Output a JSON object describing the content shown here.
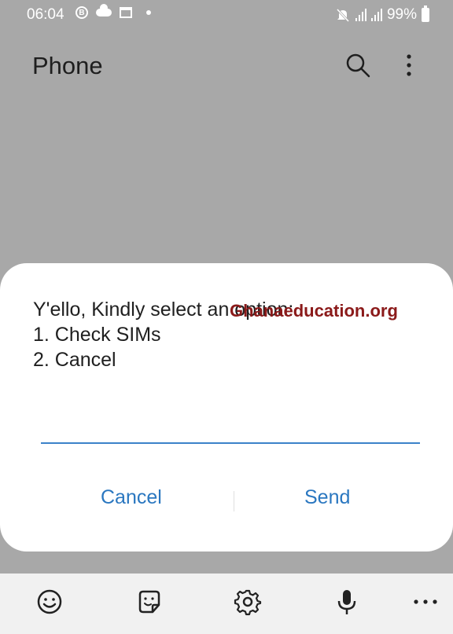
{
  "status_bar": {
    "time": "06:04",
    "badge_letter": "B",
    "battery": "99%"
  },
  "app_bar": {
    "title": "Phone",
    "icons": [
      "search-icon",
      "more-vert-icon"
    ]
  },
  "dialog": {
    "message_lines": [
      "Y'ello, Kindly select an option:",
      "1. Check SIMs",
      "2. Cancel"
    ],
    "watermark": "Ghanaeducation.org",
    "input_value": "",
    "cancel_label": "Cancel",
    "send_label": "Send"
  },
  "toolbar": {
    "icons": [
      "emoji-icon",
      "sticker-icon",
      "settings-gear-icon",
      "microphone-icon",
      "more-horiz-icon"
    ]
  },
  "colors": {
    "dim_background": "#a8a8a8",
    "accent": "#2a77c0",
    "watermark": "#8b1a1a"
  }
}
